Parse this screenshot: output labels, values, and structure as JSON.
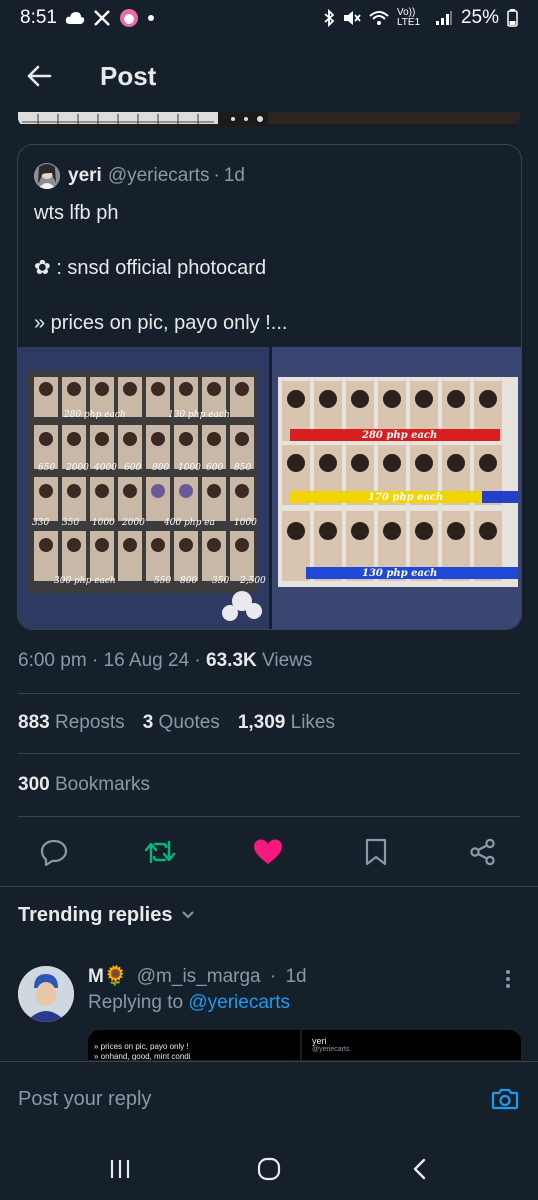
{
  "status_bar": {
    "time": "8:51",
    "network": "Vo)) LTE1",
    "battery": "25%",
    "icons": [
      "cloud-icon",
      "x-logo-icon",
      "app-icon",
      "dot-icon",
      "bluetooth-icon",
      "mute-icon",
      "wifi-icon",
      "signal-icon",
      "battery-icon"
    ]
  },
  "header": {
    "title": "Post",
    "back_icon": "arrow-left-icon"
  },
  "quote": {
    "name": "yeri",
    "handle": "@yeriecarts",
    "separator": "·",
    "time": "1d",
    "lines": [
      "wts lfb ph",
      "✿ : snsd official photocard",
      "» prices on pic, payo only !..."
    ],
    "image_left": {
      "labels": [
        "280 php each",
        "130 php each"
      ],
      "prices": [
        [
          "650",
          "2000",
          "4000",
          "600",
          "800",
          "1000",
          "600",
          "850"
        ],
        [
          "330",
          "350",
          "1000",
          "2000",
          "400 php ea",
          "1000"
        ],
        [
          "300 php each",
          "550",
          "800",
          "350",
          "2,500"
        ]
      ]
    },
    "image_right": {
      "labels": [
        "280 php each",
        "170 php each",
        "130 php each"
      ]
    }
  },
  "meta": {
    "time": "6:00 pm",
    "date": "16 Aug 24",
    "views_count": "63.3K",
    "views_label": "Views"
  },
  "stats": {
    "reposts_count": "883",
    "reposts_label": "Reposts",
    "quotes_count": "3",
    "quotes_label": "Quotes",
    "likes_count": "1,309",
    "likes_label": "Likes",
    "bookmarks_count": "300",
    "bookmarks_label": "Bookmarks"
  },
  "actions": [
    "reply-icon",
    "repost-icon",
    "like-icon",
    "bookmark-icon",
    "share-icon"
  ],
  "colors": {
    "background": "#15202b",
    "text": "#e7e9ea",
    "secondary": "#8b98a5",
    "accent": "#1d9bf0",
    "repost": "#00ba7c",
    "like": "#f91880",
    "divider": "#38444d"
  },
  "trending": {
    "label": "Trending replies"
  },
  "reply": {
    "name": "M🌻",
    "handle": "@m_is_marga",
    "separator": "·",
    "time": "1d",
    "replying_prefix": "Replying to",
    "replying_to": "@yeriecarts",
    "preview_left": "» prices on pic, payo only !",
    "preview_left_2": "» onhand, good, mint condi",
    "preview_right_name": "yeri",
    "preview_right_handle": "@yeriecarts"
  },
  "compose": {
    "placeholder": "Post your reply"
  },
  "navbar": {
    "icons": [
      "recents-icon",
      "home-icon",
      "back-icon"
    ]
  }
}
